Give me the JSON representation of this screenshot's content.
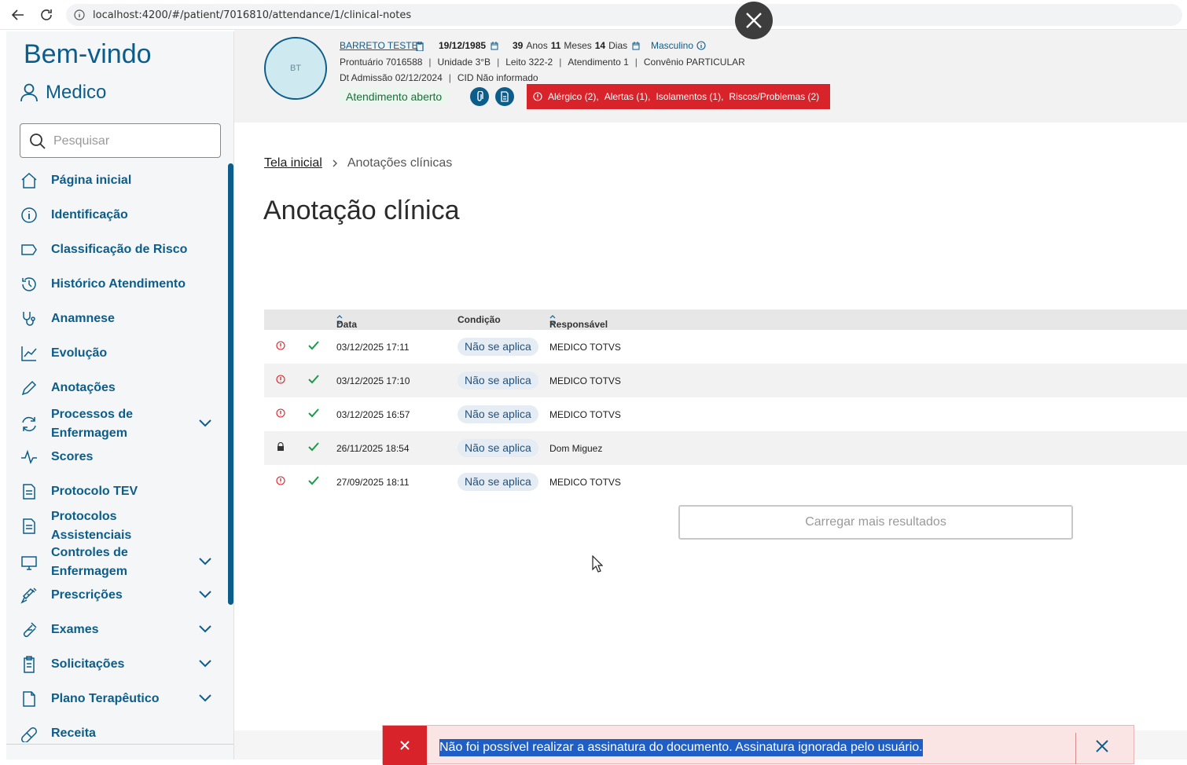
{
  "browser": {
    "url": "localhost:4200/#/patient/7016810/attendance/1/clinical-notes"
  },
  "sidebar": {
    "welcome": "Bem-vindo",
    "user": "Medico",
    "search_placeholder": "Pesquisar",
    "items": [
      {
        "label": "Página inicial",
        "icon": "home-icon"
      },
      {
        "label": "Identificação",
        "icon": "info-icon"
      },
      {
        "label": "Classificação de Risco",
        "icon": "tag-icon"
      },
      {
        "label": "Histórico Atendimento",
        "icon": "history-icon"
      },
      {
        "label": "Anamnese",
        "icon": "stethoscope-icon"
      },
      {
        "label": "Evolução",
        "icon": "chart-line-icon"
      },
      {
        "label": "Anotações",
        "icon": "pencil-icon"
      },
      {
        "label": "Processos de Enfermagem",
        "icon": "refresh-icon"
      },
      {
        "label": "Scores",
        "icon": "pulse-icon"
      },
      {
        "label": "Protocolo TEV",
        "icon": "document-icon"
      },
      {
        "label": "Protocolos Assistenciais",
        "icon": "document-icon"
      },
      {
        "label": "Controles de Enfermagem",
        "icon": "monitor-icon"
      },
      {
        "label": "Prescrições",
        "icon": "syringe-icon"
      },
      {
        "label": "Exames",
        "icon": "test-tube-icon"
      },
      {
        "label": "Solicitações",
        "icon": "clipboard-icon"
      },
      {
        "label": "Plano Terapêutico",
        "icon": "file-icon"
      },
      {
        "label": "Receita",
        "icon": "pill-icon"
      }
    ]
  },
  "patient": {
    "initials": "BT",
    "name": "BARRETO TESTE",
    "birth": "19/12/1985",
    "age_years": "39",
    "age_years_unit": "Anos",
    "age_months": "11",
    "age_months_unit": "Meses",
    "age_days": "14",
    "age_days_unit": "Dias",
    "sex": "Masculino",
    "record": "Prontuário 7016588",
    "unit": "Unidade 3°B",
    "bed": "Leito 322-2",
    "attendance": "Atendimento 1",
    "insurance": "Convênio PARTICULAR",
    "admission": "Dt Admissão 02/12/2024",
    "cid": "CID Não informado",
    "status": "Atendimento aberto",
    "alerts": [
      "Alérgico (2),",
      "Alertas (1),",
      "Isolamentos (1),",
      "Riscos/Problemas (2)"
    ]
  },
  "breadcrumb": {
    "home": "Tela inicial",
    "current": "Anotações clínicas"
  },
  "page": {
    "title": "Anotação clínica"
  },
  "table": {
    "headers": {
      "date": "Data",
      "condition": "Condição",
      "responsible": "Responsável"
    },
    "rows": [
      {
        "icon": "alert-icon",
        "date": "03/12/2025 17:11",
        "condition": "Não se aplica",
        "responsible": "MEDICO TOTVS"
      },
      {
        "icon": "alert-icon",
        "date": "03/12/2025 17:10",
        "condition": "Não se aplica",
        "responsible": "MEDICO TOTVS"
      },
      {
        "icon": "alert-icon",
        "date": "03/12/2025 16:57",
        "condition": "Não se aplica",
        "responsible": "MEDICO TOTVS"
      },
      {
        "icon": "lock-icon",
        "date": "26/11/2025 18:54",
        "condition": "Não se aplica",
        "responsible": "Dom Miguez"
      },
      {
        "icon": "alert-icon",
        "date": "27/09/2025 18:11",
        "condition": "Não se aplica",
        "responsible": "MEDICO TOTVS"
      }
    ],
    "load_more": "Carregar mais resultados"
  },
  "toast": {
    "message": "Não foi possível realizar a assinatura do documento. Assinatura ignorada pelo usuário."
  },
  "colors": {
    "primary": "#0c5d8a",
    "danger": "#d8232a",
    "success": "#1a9a4a"
  }
}
